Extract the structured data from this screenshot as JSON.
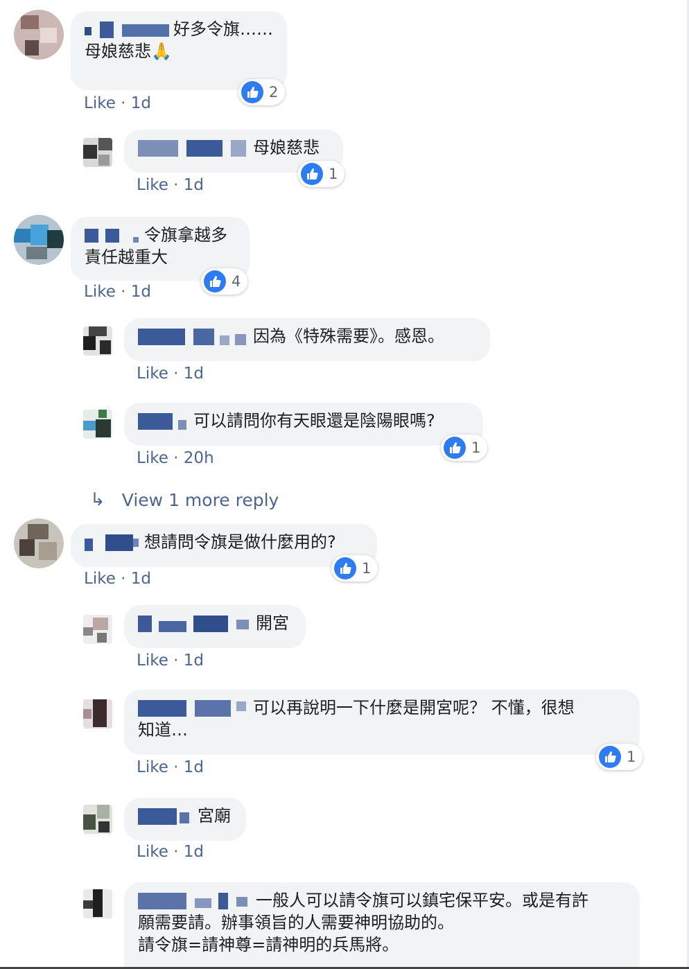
{
  "ui": {
    "like_label": "Like",
    "dot": "·",
    "view_more": "View 1 more reply",
    "colors": {
      "link": "#4b6590",
      "bubble": "#f2f3f5",
      "like_blue": "#2d7cf4"
    }
  },
  "comments": [
    {
      "text": "好多令旗……\n母娘慈悲🙏",
      "time": "1d",
      "likes": "2"
    },
    {
      "text": "母娘慈悲",
      "time": "1d",
      "likes": "1"
    },
    {
      "text": "令旗拿越多\n責任越重大",
      "time": "1d",
      "likes": "4"
    },
    {
      "text": "因為《特殊需要》。感恩。",
      "time": "1d"
    },
    {
      "text": "可以請問你有天眼還是陰陽眼嗎?",
      "time": "20h",
      "likes": "1"
    },
    {
      "text": "想請問令旗是做什麼用的?",
      "time": "1d",
      "likes": "1"
    },
    {
      "text": "開宮",
      "time": "1d"
    },
    {
      "text": "可以再說明一下什麼是開宮呢？ 不懂，很想\n知道…",
      "time": "1d",
      "likes": "1"
    },
    {
      "text": "宮廟",
      "time": "1d"
    },
    {
      "text": "一般人可以請令旗可以鎮宅保平安。或是有許\n願需要請。辦事領旨的人需要神明協助的。\n請令旗=請神尊=請神明的兵馬將。"
    }
  ]
}
